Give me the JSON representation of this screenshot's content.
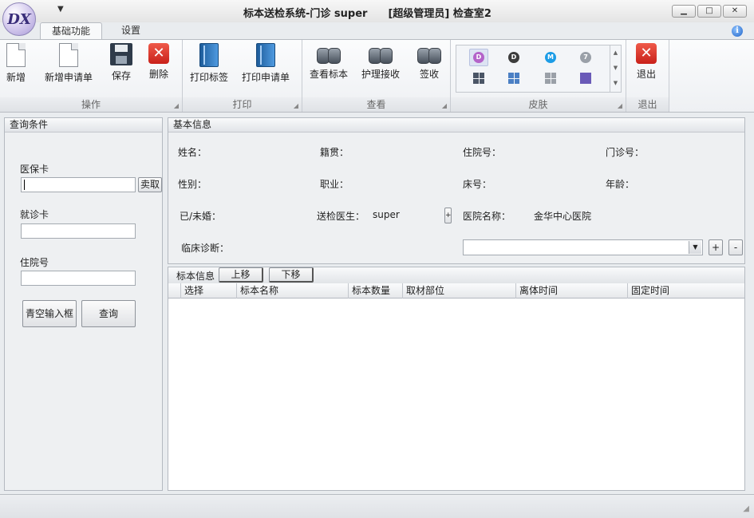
{
  "window": {
    "title": "标本送检系统-门诊 super　　[超级管理员] 检查室2",
    "logo_text": "DX",
    "controls": {
      "minimize": "▁",
      "maximize": "□",
      "close": "✕"
    }
  },
  "tabs": [
    {
      "label": "基础功能",
      "active": true
    },
    {
      "label": "设置",
      "active": false
    }
  ],
  "ribbon": {
    "groups": [
      {
        "title": "操作",
        "buttons": [
          "新增",
          "新增申请单",
          "保存",
          "删除"
        ]
      },
      {
        "title": "打印",
        "buttons": [
          "打印标签",
          "打印申请单"
        ]
      },
      {
        "title": "查看",
        "buttons": [
          "查看标本",
          "护理接收",
          "签收"
        ]
      },
      {
        "title": "皮肤",
        "buttons": []
      },
      {
        "title": "退出",
        "buttons": [
          "退出"
        ]
      }
    ],
    "skins": {
      "circles": [
        {
          "letter": "D",
          "color": "#b463c9"
        },
        {
          "letter": "D",
          "color": "#3c3c3c"
        },
        {
          "letter": "M",
          "color": "#1c9ce6"
        },
        {
          "letter": "7",
          "color": "#9aa0a8"
        }
      ],
      "squares": [
        "#4a5566",
        "#4a7fc4",
        "#9aa0a8",
        "#6a5ab8"
      ]
    }
  },
  "query": {
    "title": "查询条件",
    "insurance_card_label": "医保卡",
    "insurance_card_value": "",
    "read_button": "卖取",
    "clinic_card_label": "就诊卡",
    "clinic_card_value": "",
    "inpatient_no_label": "住院号",
    "inpatient_no_value": "",
    "clear_button": "青空输入框",
    "search_button": "查询"
  },
  "basic_info": {
    "title": "基本信息",
    "name_label": "姓名：",
    "native_label": "籍贯：",
    "inpatient_label": "住院号：",
    "outpatient_label": "门诊号：",
    "gender_label": "性别：",
    "job_label": "职业：",
    "bed_label": "床号：",
    "age_label": "年龄：",
    "married_label": "已/未婚：",
    "doctor_label": "送检医生：",
    "doctor_value": "super",
    "hospital_label": "医院名称：",
    "hospital_value": "金华中心医院",
    "diagnosis_label": "临床诊断：",
    "diagnosis_value": "",
    "add_symbol": "+",
    "remove_symbol": "-"
  },
  "specimen": {
    "title": "标本信息",
    "up_button": "上移",
    "down_button": "下移",
    "columns": [
      "选择",
      "标本名称",
      "标本数量",
      "取材部位",
      "离体时间",
      "固定时间"
    ],
    "rows": []
  }
}
